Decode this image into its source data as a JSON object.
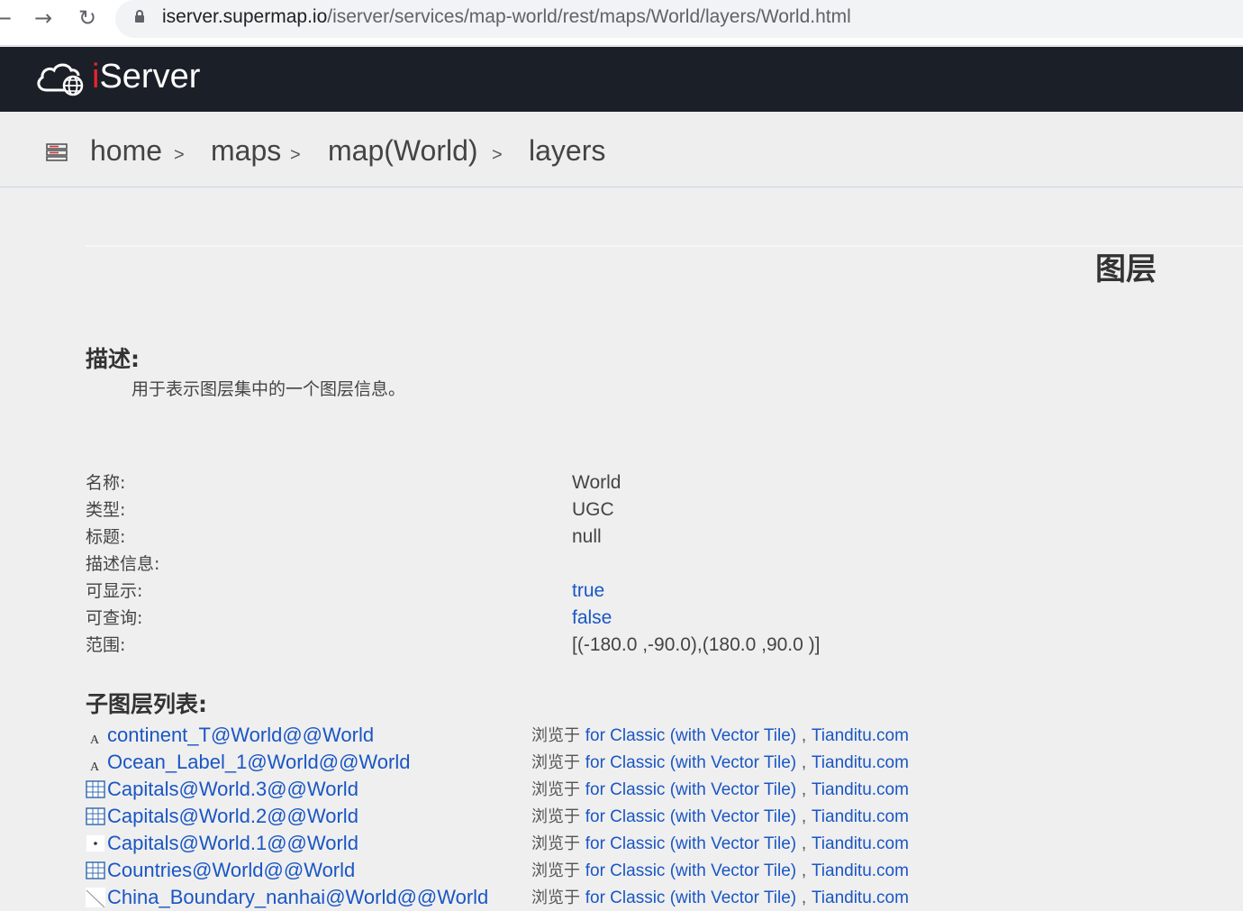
{
  "browser": {
    "url_host": "iserver.supermap.io",
    "url_path": "/iserver/services/map-world/rest/maps/World/layers/World.html"
  },
  "header": {
    "logo_first_letter": "i",
    "logo_rest": "Server"
  },
  "breadcrumb": {
    "items": [
      "home",
      "maps",
      "map(World)",
      "layers"
    ],
    "separator": ">"
  },
  "page": {
    "title": "图层",
    "description_heading": "描述:",
    "description_text": "用于表示图层集中的一个图层信息。"
  },
  "properties": [
    {
      "label": "名称:",
      "value": "World"
    },
    {
      "label": "类型:",
      "value": "UGC"
    },
    {
      "label": "标题:",
      "value": "null"
    },
    {
      "label": "描述信息:",
      "value": ""
    },
    {
      "label": "可显示:",
      "value": "true"
    },
    {
      "label": "可查询:",
      "value": "false"
    },
    {
      "label": "范围:",
      "value": "[(-180.0 ,-90.0),(180.0 ,90.0 )]"
    }
  ],
  "sublayers": {
    "heading": "子图层列表:",
    "browse_prefix": "浏览于",
    "browse_link_1": "for Classic (with Vector Tile)",
    "browse_comma": ",",
    "browse_link_2": "Tianditu.com",
    "items": [
      {
        "name": "continent_T@World@@World",
        "icon": "text-label-icon"
      },
      {
        "name": "Ocean_Label_1@World@@World",
        "icon": "text-label-icon"
      },
      {
        "name": "Capitals@World.3@@World",
        "icon": "theme-layer-icon"
      },
      {
        "name": "Capitals@World.2@@World",
        "icon": "theme-layer-icon"
      },
      {
        "name": "Capitals@World.1@@World",
        "icon": "point-layer-icon"
      },
      {
        "name": "Countries@World@@World",
        "icon": "theme-layer-icon"
      },
      {
        "name": "China_Boundary_nanhai@World@@World",
        "icon": "line-layer-icon"
      }
    ]
  },
  "colors": {
    "header_bg": "#1b1f28",
    "link": "#1a56c4",
    "page_bg": "#efefef"
  }
}
